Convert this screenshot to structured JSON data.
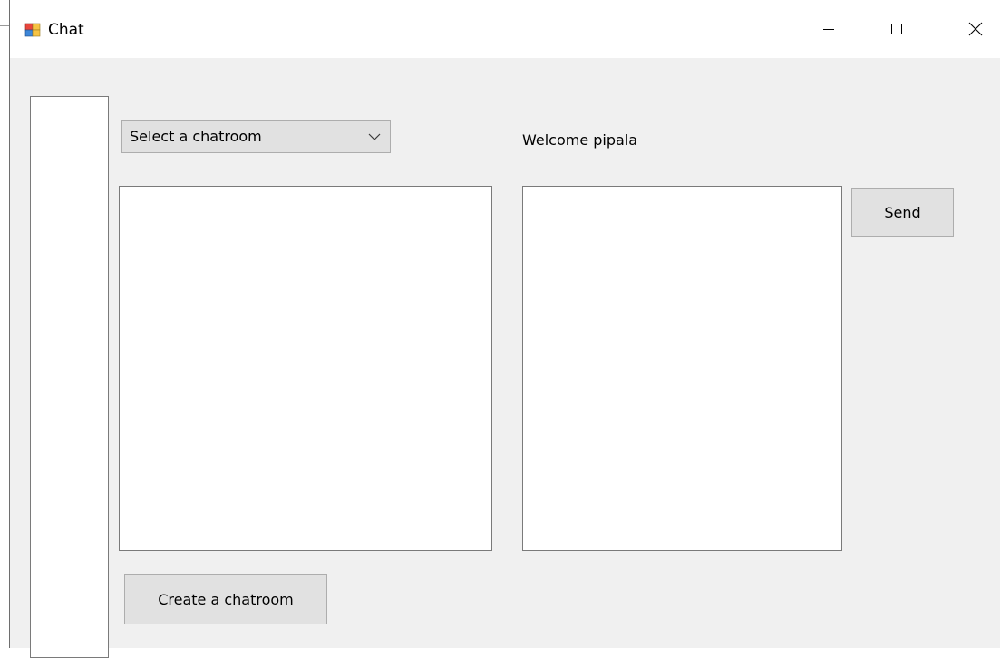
{
  "window": {
    "title": "Chat",
    "controls": {
      "minimize_icon": "minimize-icon",
      "maximize_icon": "maximize-icon",
      "close_icon": "close-icon"
    }
  },
  "chatroom_select": {
    "selected": "Select a chatroom",
    "arrow_icon": "chevron-down-icon"
  },
  "welcome_text": "Welcome pipala",
  "buttons": {
    "send_label": "Send",
    "create_chatroom_label": "Create a chatroom"
  },
  "colors": {
    "window_background": "#f0f0f0",
    "titlebar_background": "#ffffff",
    "button_background": "#e1e1e1",
    "button_border": "#adadad",
    "field_border": "#7a7a7a"
  }
}
